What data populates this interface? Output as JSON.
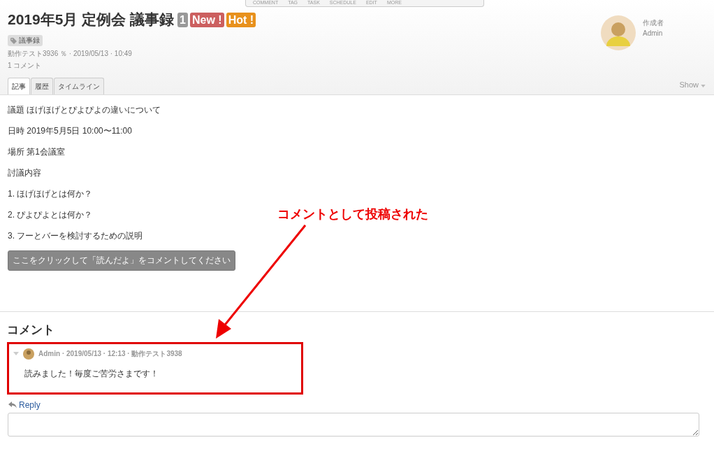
{
  "toolbar": [
    "COMMENT",
    "TAG",
    "TASK",
    "SCHEDULE",
    "EDIT",
    "MORE"
  ],
  "title": "2019年5月 定例会 議事録",
  "badges": [
    {
      "kind": "count",
      "text": "1"
    },
    {
      "kind": "new",
      "text": "New !"
    },
    {
      "kind": "hot",
      "text": "Hot !"
    }
  ],
  "tag": "議事録",
  "meta": "動作テスト3936 ％ · 2019/05/13 · 10:49",
  "comment_count": "1 コメント",
  "author": {
    "label": "作成者",
    "name": "Admin"
  },
  "tabs": [
    {
      "label": "記事",
      "selected": true
    },
    {
      "label": "履歴",
      "selected": false
    },
    {
      "label": "タイムライン",
      "selected": false
    }
  ],
  "show_menu": "Show",
  "body": [
    "議題 ほげほげとぴよぴよの違いについて",
    "日時 2019年5月5日 10:00〜11:00",
    "場所 第1会議室",
    "討議内容",
    "1. ほげほげとは何か？",
    "2. ぴよぴよとは何か？",
    "3. フーとバーを検討するための説明"
  ],
  "action_button": "ここをクリックして「読んだよ」をコメントしてください",
  "comments_heading": "コメント",
  "comments": [
    {
      "meta": "Admin · 2019/05/13 · 12:13 · 動作テスト3938",
      "text": "読みました！毎度ご苦労さまです！",
      "highlighted": true
    }
  ],
  "reply_link": "Reply",
  "annotation": "コメントとして投稿された"
}
